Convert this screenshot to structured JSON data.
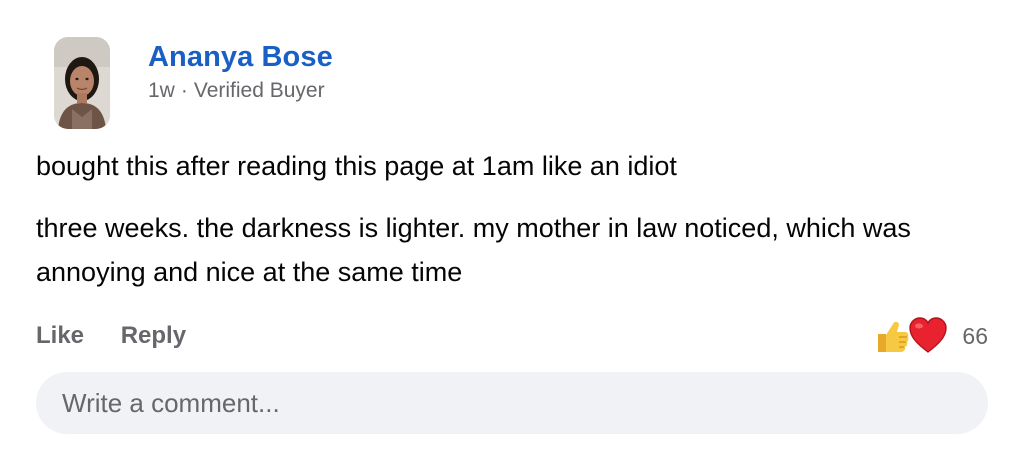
{
  "comment": {
    "author": "Ananya Bose",
    "time": "1w",
    "separator": "·",
    "badge": "Verified Buyer",
    "paragraphs": [
      "bought this after reading this page at 1am like an idiot",
      "three weeks. the darkness is lighter. my mother in law noticed, which was annoying and nice at the same time"
    ]
  },
  "actions": {
    "like_label": "Like",
    "reply_label": "Reply"
  },
  "reactions": {
    "icons": [
      "thumbs-up-icon",
      "heart-icon"
    ],
    "count": "66"
  },
  "composer": {
    "placeholder": "Write a comment..."
  },
  "colors": {
    "author": "#1a5fc4",
    "muted": "#65676b",
    "input_bg": "#f0f2f5"
  }
}
